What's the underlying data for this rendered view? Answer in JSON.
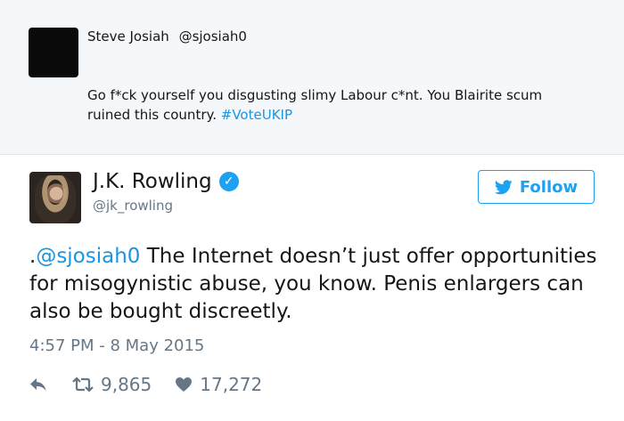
{
  "quoted": {
    "name": "Steve Josiah",
    "handle": "@sjosiah0",
    "text": "Go f*ck yourself you disgusting slimy Labour c*nt. You Blairite scum ruined this country. ",
    "hashtag": "#VoteUKIP"
  },
  "tweet": {
    "name": "J.K. Rowling",
    "verified_icon": "verified-badge-icon",
    "handle": "@jk_rowling",
    "follow_label": "Follow",
    "text_prefix": ".",
    "mention": "@sjosiah0",
    "text": " The Internet doesn’t just offer opportunities for misogynistic abuse, you know. Penis enlargers can also be bought discreetly.",
    "timestamp": "4:57 PM - 8 May 2015",
    "retweets": "9,865",
    "likes": "17,272"
  },
  "colors": {
    "link": "#1b95e0",
    "twitter_blue": "#1da1f2",
    "muted": "#657786",
    "quoted_bg": "#f5f8fa"
  }
}
